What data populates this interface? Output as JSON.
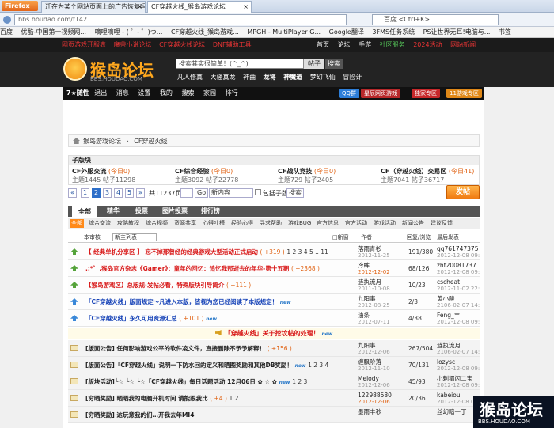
{
  "browser": {
    "app_button": "Firefox",
    "tabs": [
      {
        "label": "迁在为某个网站页面上的广告恢复吗..."
      },
      {
        "label": "CF穿越火线_猴岛游戏论坛",
        "active": true
      }
    ],
    "url": "bbs.houdao.com/f142",
    "search_placeholder": "百度 <Ctrl+K>",
    "bookmarks": [
      "百度",
      "优酷-中国第一视频网...",
      "嘀哩嘀哩 - ( ゜- ゜)つ...",
      "CF穿越火线_猴岛游戏...",
      "MPGH - MultiPlayer G...",
      "Google翻译",
      "3FMS任务系统",
      "PS让世界无耳!电脑与...",
      "书签"
    ]
  },
  "topstrip": {
    "left_links": [
      "网页游戏开服表",
      "魔兽小说论坛",
      "CF穿越火线论坛",
      "DNF辅助工具"
    ],
    "right_links": [
      "首页",
      "论坛",
      "手游",
      "社区服务",
      "2024活动",
      "网站新闻"
    ]
  },
  "header": {
    "logo_text": "猴岛论坛",
    "logo_url": "BBS.HOUDAO.COM",
    "search_placeholder": "搜索其实很简单！(^_^)",
    "search_select": "帖子",
    "search_button": "搜索",
    "links": [
      "凡人修真",
      "大骚真龙",
      "神曲",
      "龙将",
      "神魔道",
      "梦幻飞仙",
      "冒险计"
    ]
  },
  "sitenav": {
    "brand": "7★随性",
    "items": [
      "退出",
      "消息",
      "设置",
      "我的",
      "搜索",
      "家园",
      "排行"
    ],
    "badges": [
      "QQ群",
      "星辰网页游戏",
      "独家专区",
      "11游戏专区"
    ]
  },
  "breadcrumb": {
    "root": "猴岛游戏论坛",
    "current": "CF穿越火线"
  },
  "subforums": {
    "heading": "子版块",
    "items": [
      {
        "name": "CF外服交流",
        "today": "(今日0)",
        "stats": "主题1445  帖子11298"
      },
      {
        "name": "CF综合经验",
        "today": "(今日0)",
        "stats": "主题3092  帖子22778"
      },
      {
        "name": "CF战队竞技",
        "today": "(今日0)",
        "stats": "主题729  帖子2405"
      },
      {
        "name": "CF（穿越火线）交易区",
        "today": "(今日41)",
        "stats": "主题7041  帖子36717"
      }
    ]
  },
  "pager": {
    "prev": "«",
    "pages": [
      "1",
      "2",
      "3",
      "4",
      "5",
      "»"
    ],
    "current": "2",
    "total": "共11237页",
    "go": "Go",
    "order": "新内容",
    "subforum_check": "包括子版块",
    "search": "搜索",
    "post_button": "发帖"
  },
  "tabs": [
    "全部",
    "精华",
    "投票",
    "图片投票",
    "排行榜"
  ],
  "categories": [
    "全部",
    "综合交流",
    "攻略教程",
    "综合视频",
    "资源共享",
    "心得吐槽",
    "经验心得",
    "寻求帮助",
    "游戏BUG",
    "官方信息",
    "官方活动",
    "游戏活动",
    "新闻公告",
    "建议反馈"
  ],
  "columns": {
    "sort_label": "本审核",
    "filter": "新主列表",
    "filter_box": "□新窗",
    "author": "作者",
    "replies": "回复/浏览",
    "last": "最后发表"
  },
  "threads": [
    {
      "icon": "up",
      "style": "rt-red",
      "title": "【 经典单机分享区 】    忘不掉那曾经的经典游戏大型活动正式启动",
      "points": "( +319 )",
      "pages": "1 2 3 4 5 .. 11",
      "author": "落雨青衫",
      "date": "2012-11-25",
      "hot": false,
      "replies": "191/380",
      "last_user": "qq761747375",
      "last_date": "2012-12-08 09:41"
    },
    {
      "icon": "up",
      "style": "rt-red",
      "title": ".:*゜.猴岛官方杂志《Gamer》：童年的回忆：追忆我那逝去的年华-第十五期",
      "points": "( +2368 )",
      "pages": "",
      "author": "冷眸",
      "date": "2012-12-02",
      "hot": true,
      "replies": "68/126",
      "last_user": "zht20081737",
      "last_date": "2012-12-08 09:55"
    },
    {
      "icon": "up",
      "style": "rt-red",
      "title": "【猴岛游戏区】总版规·发帖必看，特殊版块引导简介",
      "points": "( +111 )",
      "pages": "",
      "author": "涟执流月",
      "date": "2011-10-08",
      "hot": false,
      "replies": "10/23",
      "last_user": "cscheat",
      "last_date": "2012-11-02 22:30"
    },
    {
      "icon": "upb",
      "style": "rt-blue",
      "title": "「CF穿越火线」版面规定～凡进入本版，皆视为您已经阅读了本版规定！",
      "points": "",
      "pages": "",
      "author": "九阳事",
      "date": "2012-08-25",
      "hot": false,
      "replies": "2/3",
      "last_user": "黄小酸",
      "last_date": "2106-02-07 14:49"
    },
    {
      "icon": "upb",
      "style": "rt-blue",
      "title": "「CF穿越火线」永久可用资源汇总",
      "points": "( +101 )",
      "pages": "",
      "author": "油条",
      "date": "2012-07-11",
      "hot": false,
      "replies": "4/38",
      "last_user": "Feng_丰",
      "last_date": "2012-12-08 09:57"
    }
  ],
  "announcement": "「穿越火线」关于挖坟帖的处理！",
  "normal_threads": [
    {
      "title": "[版面公告] 任何影响游戏公平的软件凌文件，直接删除不予予解释！",
      "points": "( +156 )",
      "pages": "",
      "author": "九阳事",
      "date": "2012-12-06",
      "hot": false,
      "replies": "267/504",
      "last_user": "涟执流月",
      "last_date": "2106-02-07 14:49"
    },
    {
      "title": "[版面公告]「CF穿越火线」说明一下防水回的定义和晒图奖励和其他DB奖励！",
      "points": "",
      "pages": "1 2 3 4",
      "author": "缠飘阶落",
      "date": "2012-11-10",
      "hot": false,
      "replies": "70/131",
      "last_user": "lozysc",
      "last_date": "2012-12-08 09:42"
    },
    {
      "title": "[版块活动]╰☆ ╰☆ ╰☆「CF穿越火线」每日话题活动 12月06日 ✿ ☆ ✿",
      "points": "",
      "pages": "1 2 3",
      "author": "Melody",
      "date": "2012-12-06",
      "hot": false,
      "replies": "45/93",
      "last_user": "小刺猬闪二宝",
      "last_date": "2012-12-08 09:40"
    },
    {
      "title": "[穷晒奖励] 晒晒我的电脑开机时间   请能跟我比",
      "points": "( +4 )",
      "pages": "1 2",
      "author": "122988580",
      "date": "2012-12-06",
      "hot": true,
      "replies": "20/36",
      "last_user": "kabeiou",
      "last_date": "2012-12-08 09:57"
    },
    {
      "title": "[穷晒奖励] 这玩意我的们…开我去年MI4",
      "points": "",
      "pages": "",
      "author": "墨雨丰秒",
      "date": "",
      "hot": false,
      "replies": "",
      "last_user": "丝幻暗一丁",
      "last_date": ""
    }
  ],
  "watermark": {
    "title": "猴岛论坛",
    "url": "BBS.HOUDAO.COM"
  },
  "colors": {
    "accent": "#ff8a1a",
    "brand_dark": "#232323",
    "link_blue": "#1844b8",
    "hot_red": "#d81818"
  }
}
